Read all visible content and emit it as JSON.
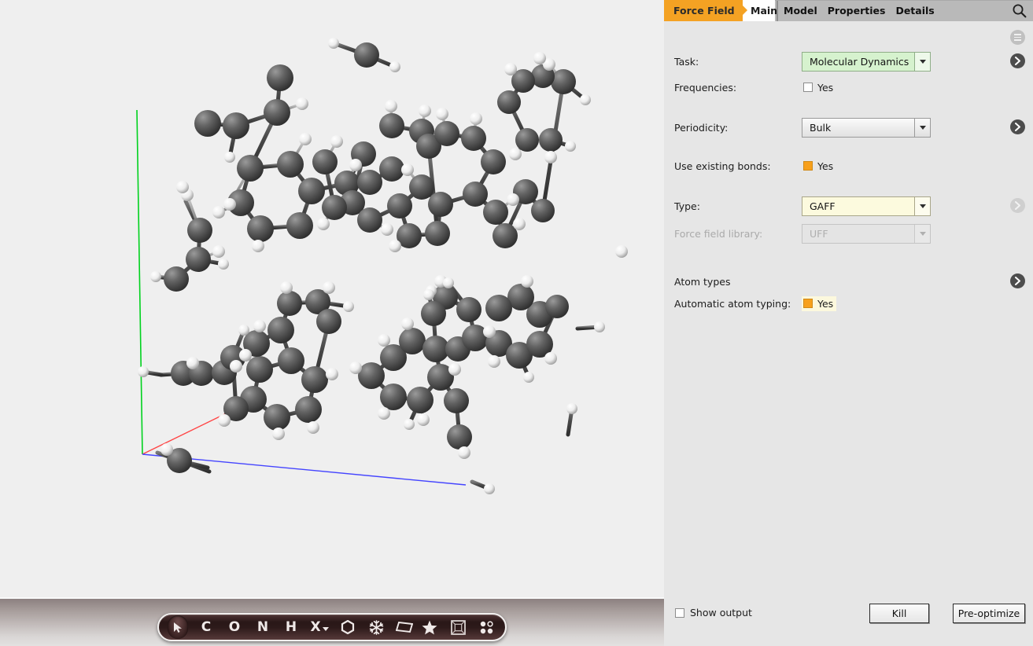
{
  "window": {
    "app": "Force Field setup",
    "panel_bg": "#e6e6e6",
    "accent": "#f4a223"
  },
  "tabs": {
    "primary": "Force Field",
    "current_sub": "Main",
    "items": [
      {
        "label": "Model"
      },
      {
        "label": "Properties"
      },
      {
        "label": "Details"
      }
    ],
    "search_icon": "search-icon",
    "menu_icon": "hamburger-menu-icon"
  },
  "form": {
    "task": {
      "label": "Task:",
      "value": "Molecular Dynamics",
      "state": "modified-green",
      "has_detail_button": true
    },
    "frequencies": {
      "label": "Frequencies:",
      "checkbox_label": "Yes",
      "checked": false,
      "highlighted": false
    },
    "periodicity": {
      "label": "Periodicity:",
      "value": "Bulk",
      "state": "normal",
      "has_detail_button": true
    },
    "use_existing_bonds": {
      "label": "Use existing bonds:",
      "checkbox_label": "Yes",
      "checked": true,
      "highlighted": false
    },
    "type": {
      "label": "Type:",
      "value": "GAFF",
      "state": "modified-yellow",
      "has_detail_button": true,
      "detail_button_enabled": false
    },
    "force_field_library": {
      "label": "Force field library:",
      "value": "UFF",
      "state": "disabled",
      "has_detail_button": false
    },
    "atom_types": {
      "label": "Atom types",
      "has_detail_button": true
    },
    "automatic_atom_typing": {
      "label": "Automatic atom typing:",
      "checkbox_label": "Yes",
      "checked": true,
      "highlighted": true
    }
  },
  "footer": {
    "show_output_label": "Show output",
    "show_output_checked": false,
    "kill_label": "Kill",
    "preoptimize_label": "Pre-optimize"
  },
  "toolbar": {
    "tools": [
      {
        "name": "select-cursor-tool",
        "glyph": "cursor",
        "selected": true
      },
      {
        "name": "carbon-tool",
        "glyph": "C",
        "selected": false
      },
      {
        "name": "oxygen-tool",
        "glyph": "O",
        "selected": false
      },
      {
        "name": "nitrogen-tool",
        "glyph": "N",
        "selected": false
      },
      {
        "name": "hydrogen-tool",
        "glyph": "H",
        "selected": false
      },
      {
        "name": "element-picker-tool",
        "glyph": "X",
        "selected": false,
        "has_dropdown": true
      },
      {
        "name": "ring-tool",
        "glyph": "hexagon",
        "selected": false
      },
      {
        "name": "snowflake-tool",
        "glyph": "snowflake",
        "selected": false
      },
      {
        "name": "plane-tool",
        "glyph": "plane",
        "selected": false
      },
      {
        "name": "star-tool",
        "glyph": "star",
        "selected": false
      },
      {
        "name": "unit-cell-tool",
        "glyph": "cube",
        "selected": false
      },
      {
        "name": "dots-tool",
        "glyph": "dots",
        "selected": false
      }
    ]
  },
  "viewport": {
    "background": "#efefef",
    "atom_colors": {
      "carbon": "#4a4a4a",
      "hydrogen": "#f2f2f2"
    },
    "axes": [
      {
        "name": "b-axis",
        "color": "#00d21e"
      },
      {
        "name": "a-axis",
        "color": "#ff4444"
      },
      {
        "name": "c-axis",
        "color": "#4444ff"
      }
    ]
  }
}
